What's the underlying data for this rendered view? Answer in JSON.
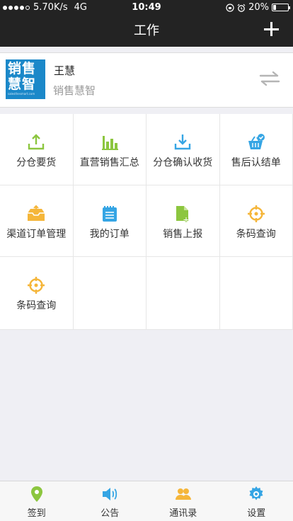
{
  "status_bar": {
    "carrier": "5.70K/s",
    "network": "4G",
    "time": "10:49",
    "battery": "20%",
    "battery_level": 0.2
  },
  "nav": {
    "title": "工作",
    "add_icon": "plus-icon"
  },
  "user": {
    "name": "王慧",
    "company": "销售慧智",
    "logo_line1": "销售",
    "logo_line2": "慧智",
    "logo_url": "salesthesmart.com"
  },
  "menu": [
    {
      "label": "分仓要货",
      "icon": "upload-icon",
      "color": "#8cc63f"
    },
    {
      "label": "直营销售汇总",
      "icon": "bar-chart-icon",
      "color": "#8cc63f"
    },
    {
      "label": "分仓确认收货",
      "icon": "download-icon",
      "color": "#35a5e4"
    },
    {
      "label": "售后认结单",
      "icon": "basket-check-icon",
      "color": "#35a5e4"
    },
    {
      "label": "渠道订单管理",
      "icon": "inbox-icon",
      "color": "#f5b63a"
    },
    {
      "label": "我的订单",
      "icon": "notepad-icon",
      "color": "#35a5e4"
    },
    {
      "label": "销售上报",
      "icon": "file-add-icon",
      "color": "#8cc63f"
    },
    {
      "label": "条码查询",
      "icon": "crosshair-icon",
      "color": "#f5b63a"
    },
    {
      "label": "条码查询",
      "icon": "crosshair-icon",
      "color": "#f5b63a"
    }
  ],
  "tabs": [
    {
      "label": "签到",
      "icon": "location-pin-icon",
      "color": "#8cc63f"
    },
    {
      "label": "公告",
      "icon": "speaker-icon",
      "color": "#35a5e4"
    },
    {
      "label": "通讯录",
      "icon": "contacts-icon",
      "color": "#f5b63a"
    },
    {
      "label": "设置",
      "icon": "gear-icon",
      "color": "#35a5e4"
    }
  ]
}
